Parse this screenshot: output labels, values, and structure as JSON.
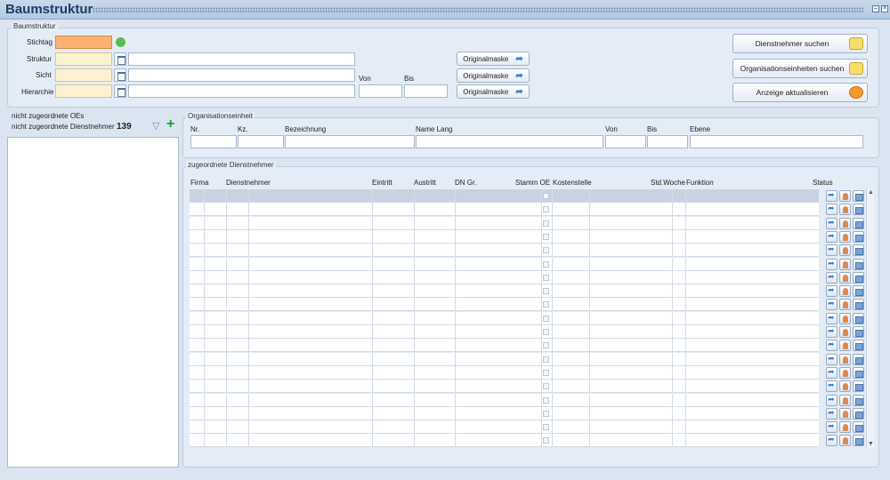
{
  "window": {
    "title": "Baumstruktur",
    "min": "–",
    "close": "×"
  },
  "baum": {
    "group_label": "Baumstruktur",
    "stichtag": "Stichtag",
    "struktur": "Struktur",
    "sicht": "Sicht",
    "hierarchie": "Hierarchie",
    "von": "Von",
    "bis": "Bis",
    "originalmaske": "Originalmaske"
  },
  "actions": {
    "dienstnehmer_suchen": "Dienstnehmer suchen",
    "oe_suchen": "Organisationseinheiten suchen",
    "anzeige": "Anzeige aktualisieren"
  },
  "left": {
    "oes": "nicht zugeordnete OEs",
    "dn": "nicht zugeordnete Dienstnehmer",
    "count": "139"
  },
  "oe": {
    "group_label": "Organisationseinheit",
    "nr": "Nr.",
    "kz": "Kz.",
    "bezeichnung": "Bezeichnung",
    "name_lang": "Name Lang",
    "von": "Von",
    "bis": "Bis",
    "ebene": "Ebene"
  },
  "dn": {
    "group_label": "zugeordnete Dienstnehmer",
    "columns": [
      "Firma",
      "Dienstnehmer",
      "Eintritt",
      "Austritt",
      "DN Gr.",
      "Stamm OE",
      "Kostenstelle",
      "Std.Woche",
      "Funktion",
      "Status"
    ],
    "row_count": 19
  },
  "colors": {
    "accent": "#3a7bd5",
    "stichtag_fill": "#f9b273",
    "input_fill": "#fdf2cf"
  }
}
